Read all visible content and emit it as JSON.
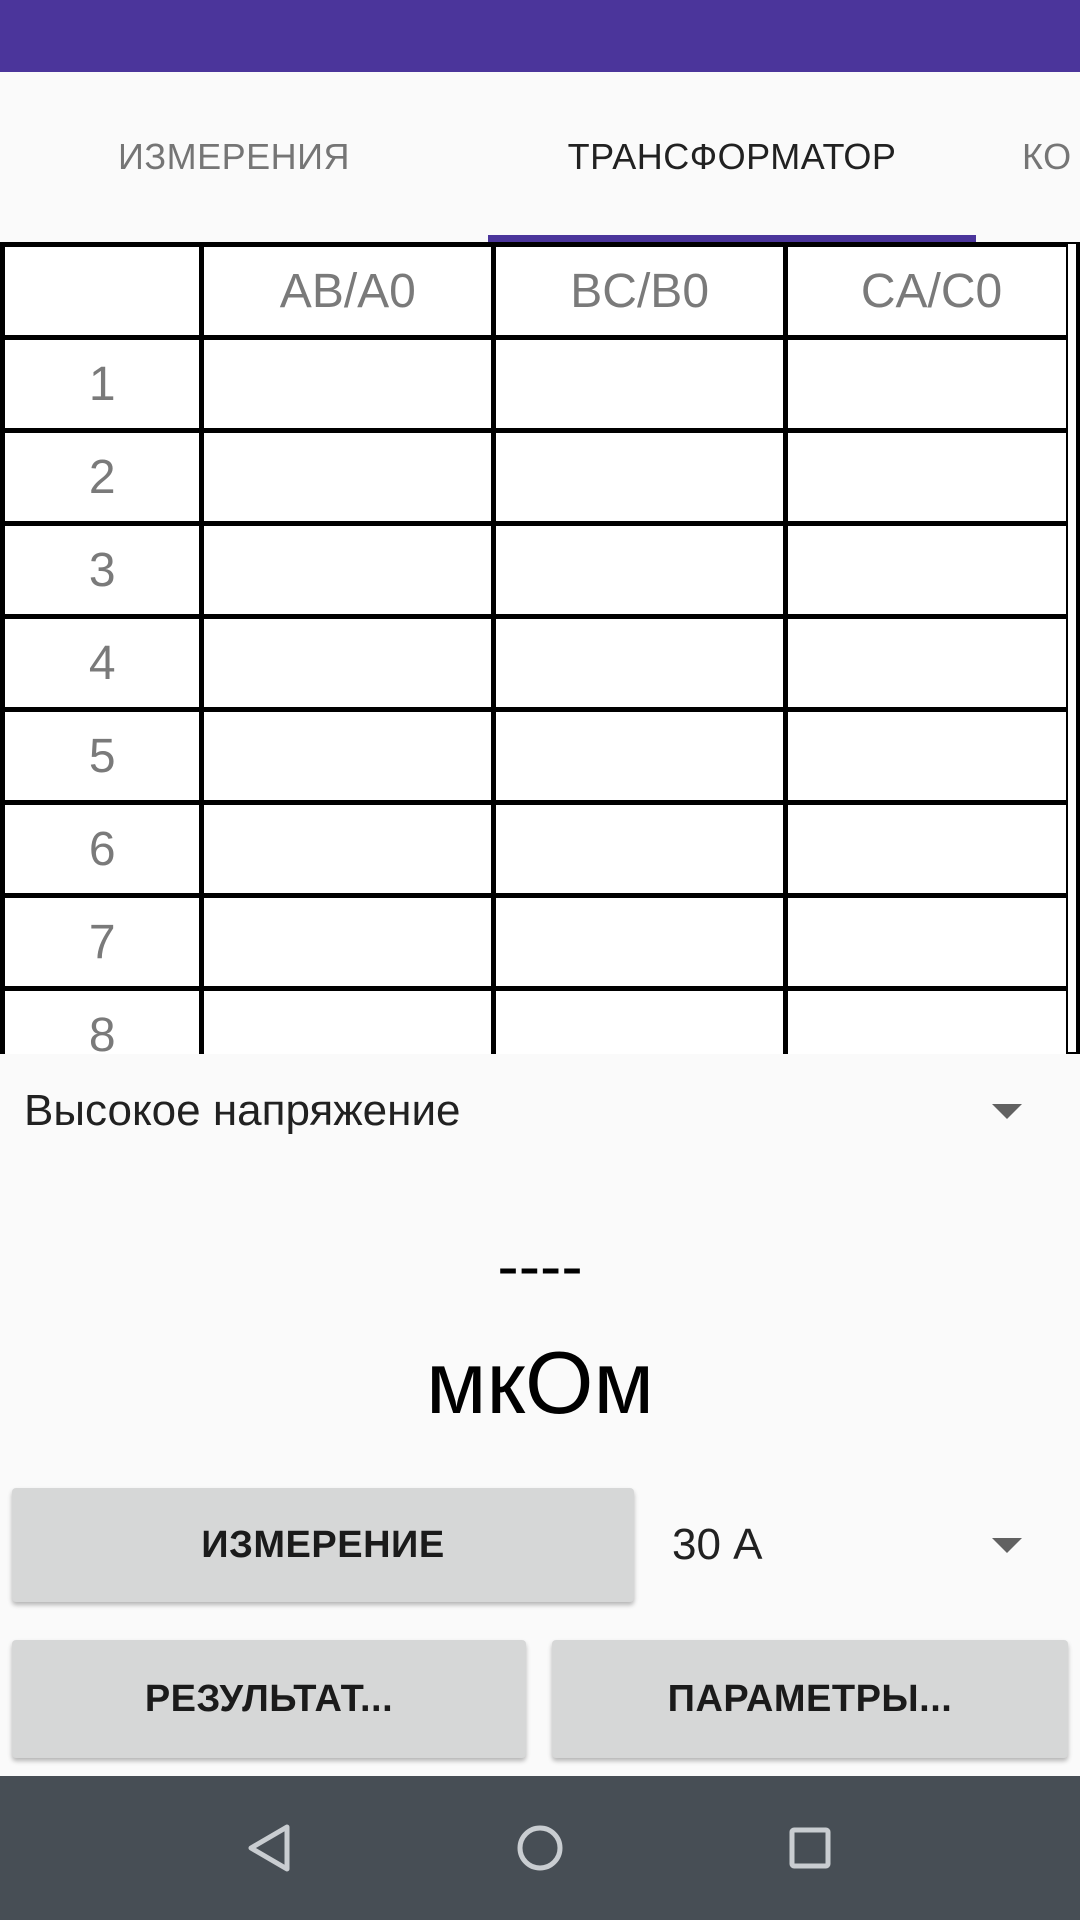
{
  "tabs": [
    {
      "label": "ИЗМЕРЕНИЯ",
      "active": false
    },
    {
      "label": "ТРАНСФОРМАТОР",
      "active": true
    },
    {
      "label": "КО",
      "active": false
    }
  ],
  "table": {
    "columns": [
      "",
      "AB/A0",
      "BC/B0",
      "CA/C0"
    ],
    "rows": [
      {
        "label": "1",
        "cells": [
          "",
          "",
          ""
        ]
      },
      {
        "label": "2",
        "cells": [
          "",
          "",
          ""
        ]
      },
      {
        "label": "3",
        "cells": [
          "",
          "",
          ""
        ]
      },
      {
        "label": "4",
        "cells": [
          "",
          "",
          ""
        ]
      },
      {
        "label": "5",
        "cells": [
          "",
          "",
          ""
        ]
      },
      {
        "label": "6",
        "cells": [
          "",
          "",
          ""
        ]
      },
      {
        "label": "7",
        "cells": [
          "",
          "",
          ""
        ]
      },
      {
        "label": "8",
        "cells": [
          "",
          "",
          ""
        ]
      },
      {
        "label": "",
        "cells": [
          "",
          "",
          ""
        ]
      }
    ]
  },
  "winding_select": {
    "value": "Высокое напряжение"
  },
  "reading": {
    "value": "----",
    "unit": "мкОм"
  },
  "controls": {
    "measure_label": "ИЗМЕРЕНИЕ",
    "current_select": "30 А",
    "results_label": "РЕЗУЛЬТАТ...",
    "params_label": "ПАРАМЕТРЫ..."
  },
  "colors": {
    "accent": "#4b359b",
    "nav_bar": "#474e55",
    "button": "#d6d7d7"
  },
  "icons": {
    "back": "back-triangle-icon",
    "home": "home-circle-icon",
    "recents": "recents-square-icon"
  }
}
